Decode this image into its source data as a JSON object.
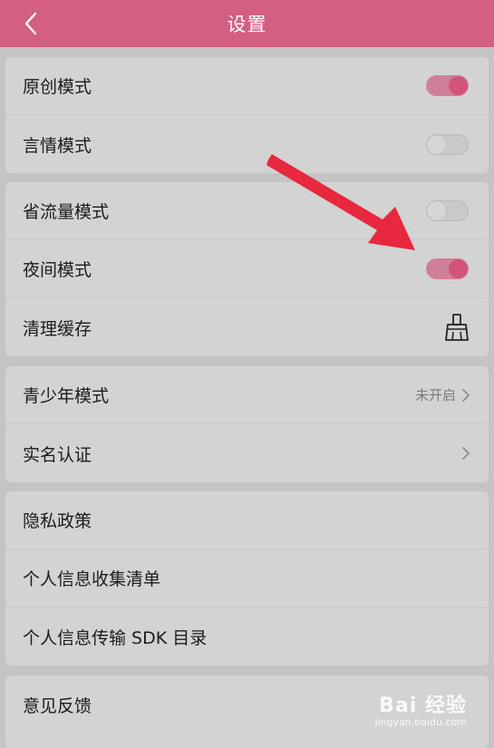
{
  "header": {
    "title": "设置"
  },
  "groups": [
    {
      "rows": [
        {
          "label": "原创模式",
          "toggle": "on"
        },
        {
          "label": "言情模式",
          "toggle": "off"
        }
      ]
    },
    {
      "rows": [
        {
          "label": "省流量模式",
          "toggle": "off"
        },
        {
          "label": "夜间模式",
          "toggle": "on"
        },
        {
          "label": "清理缓存",
          "icon": "broom-icon"
        }
      ]
    },
    {
      "rows": [
        {
          "label": "青少年模式",
          "status": "未开启",
          "icon": "chevron-right-icon"
        },
        {
          "label": "实名认证",
          "icon": "chevron-right-icon"
        }
      ]
    },
    {
      "rows": [
        {
          "label": "隐私政策"
        },
        {
          "label": "个人信息收集清单"
        },
        {
          "label": "个人信息传输 SDK 目录"
        }
      ]
    },
    {
      "rows": [
        {
          "label": "意见反馈"
        }
      ]
    }
  ],
  "colors": {
    "accent": "#d35f83",
    "toggle_on_track": "#cf7f97",
    "toggle_on_knob": "#d2547a",
    "annotation_arrow": "#e8283f"
  },
  "watermark": {
    "logo": "Bai 经验",
    "url": "jingyan.baidu.com"
  }
}
